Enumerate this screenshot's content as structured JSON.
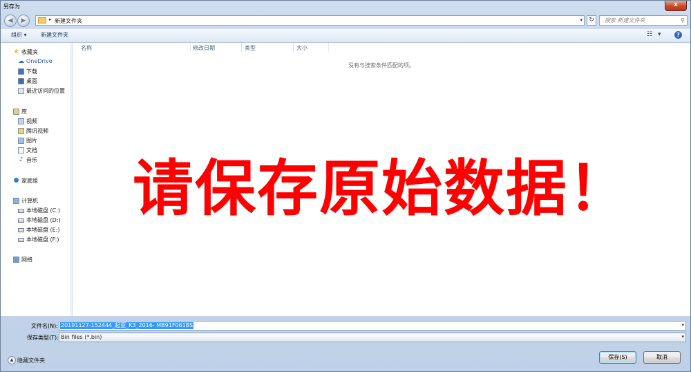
{
  "window": {
    "title": "另存为",
    "close_label": "x"
  },
  "nav": {
    "back_label": "◀",
    "forward_label": "▶",
    "path": "新建文件夹",
    "search_placeholder": "搜索 新建文件夹"
  },
  "toolbar": {
    "organize_label": "组织 ▾",
    "new_folder_label": "新建文件夹",
    "help_label": "?"
  },
  "sidebar": {
    "items": [
      {
        "label": "收藏夹",
        "icon": "star-icon"
      },
      {
        "label": "OneDrive",
        "icon": "cloud-icon"
      },
      {
        "label": "下载",
        "icon": "download-folder-icon"
      },
      {
        "label": "桌面",
        "icon": "desktop-icon"
      },
      {
        "label": "最近访问的位置",
        "icon": "recent-places-icon"
      },
      {
        "label": "库",
        "icon": "library-icon"
      },
      {
        "label": "视频",
        "icon": "video-icon"
      },
      {
        "label": "腾讯视频",
        "icon": "tencent-video-icon"
      },
      {
        "label": "图片",
        "icon": "pictures-icon"
      },
      {
        "label": "文档",
        "icon": "documents-icon"
      },
      {
        "label": "音乐",
        "icon": "music-icon"
      },
      {
        "label": "家庭组",
        "icon": "homegroup-icon"
      },
      {
        "label": "计算机",
        "icon": "computer-icon"
      },
      {
        "label": "本地磁盘 (C:)",
        "icon": "drive-c-icon"
      },
      {
        "label": "本地磁盘 (D:)",
        "icon": "drive-icon"
      },
      {
        "label": "本地磁盘 (E:)",
        "icon": "drive-icon"
      },
      {
        "label": "本地磁盘 (F:)",
        "icon": "drive-icon"
      },
      {
        "label": "网络",
        "icon": "network-icon"
      }
    ]
  },
  "file_list": {
    "columns": [
      "名称",
      "修改日期",
      "类型",
      "大小"
    ],
    "empty_message": "没有与搜索条件匹配的项。",
    "overlay_text": "请保存原始数据！"
  },
  "save_form": {
    "filename_label": "文件名(N):",
    "filename_value": "20191127-152444_起亚_K3_2016- MB91F061BS",
    "filetype_label": "保存类型(T):",
    "filetype_value": "Bin files (*.bin)",
    "hide_folders_label": "隐藏文件夹",
    "save_button": "保存(S)",
    "cancel_button": "取消"
  },
  "colors": {
    "overlay_red": "#ff0000",
    "selection_blue": "#3399ff",
    "window_frame": "#c9d9ec"
  }
}
